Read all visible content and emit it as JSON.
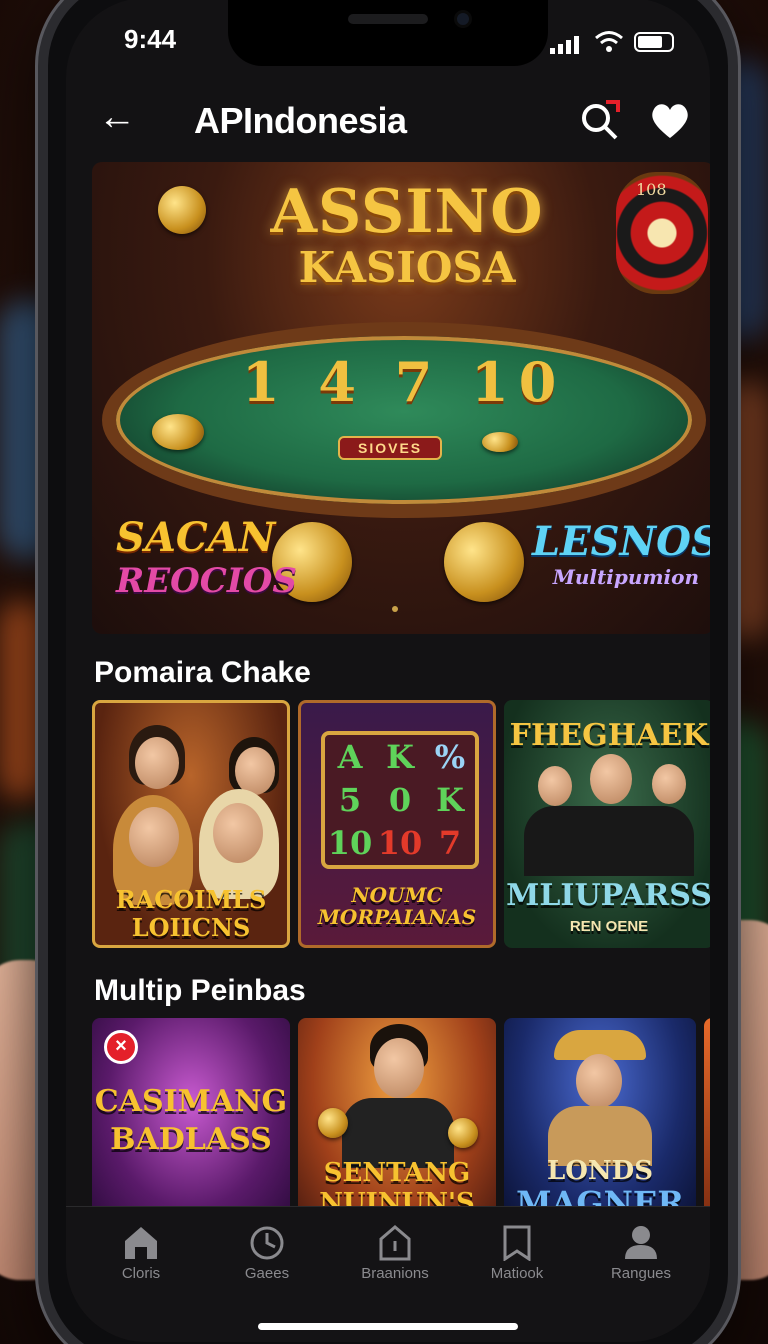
{
  "status_bar": {
    "time": "9:44"
  },
  "header": {
    "title": "APIndonesia"
  },
  "hero": {
    "logo_line1": "ASSINO",
    "logo_line2": "KASIOSA",
    "table_numbers": "1 4 7 10",
    "table_plate": "SIOVES",
    "roulette_number": "108",
    "badge_left_line1": "SACAN",
    "badge_left_line2": "REOCIOS",
    "badge_right_line1": "LESNOS",
    "badge_right_line2": "Multipumion"
  },
  "sections": [
    {
      "title": "Pomaira Chake",
      "cards": [
        {
          "caption_line1": "RACOIMLS",
          "caption_line2": "LOIICNS"
        },
        {
          "caption_line1": "NOUMC",
          "caption_line2": "MORPAIANAS",
          "reels": [
            "A",
            "K",
            "%",
            "5",
            "0",
            "K",
            "10",
            "10",
            "7"
          ]
        },
        {
          "caption_top": "FHEGHAEK",
          "caption_line1": "MLIUPARSS",
          "caption_line2": "REN OENE"
        }
      ]
    },
    {
      "title": "Multip Peinbas",
      "cards": [
        {
          "caption_line1": "CASIMANG",
          "caption_line2": "BADLASS"
        },
        {
          "caption_line1": "SENTANG",
          "caption_line2": "NUINUN'S"
        },
        {
          "caption_line1": "LONDS",
          "caption_line2": "MAGNER"
        }
      ]
    }
  ],
  "tabbar": [
    {
      "label": "Cloris",
      "icon": "home-icon"
    },
    {
      "label": "Gaees",
      "icon": "clock-icon"
    },
    {
      "label": "Braanions",
      "icon": "house-outline-icon"
    },
    {
      "label": "Matiook",
      "icon": "bookmark-icon"
    },
    {
      "label": "Rangues",
      "icon": "profile-icon"
    }
  ],
  "colors": {
    "screen_bg": "#131214",
    "accent_red": "#e4202a",
    "gold": "#f5c542",
    "tab_inactive": "#8a8a8e"
  }
}
